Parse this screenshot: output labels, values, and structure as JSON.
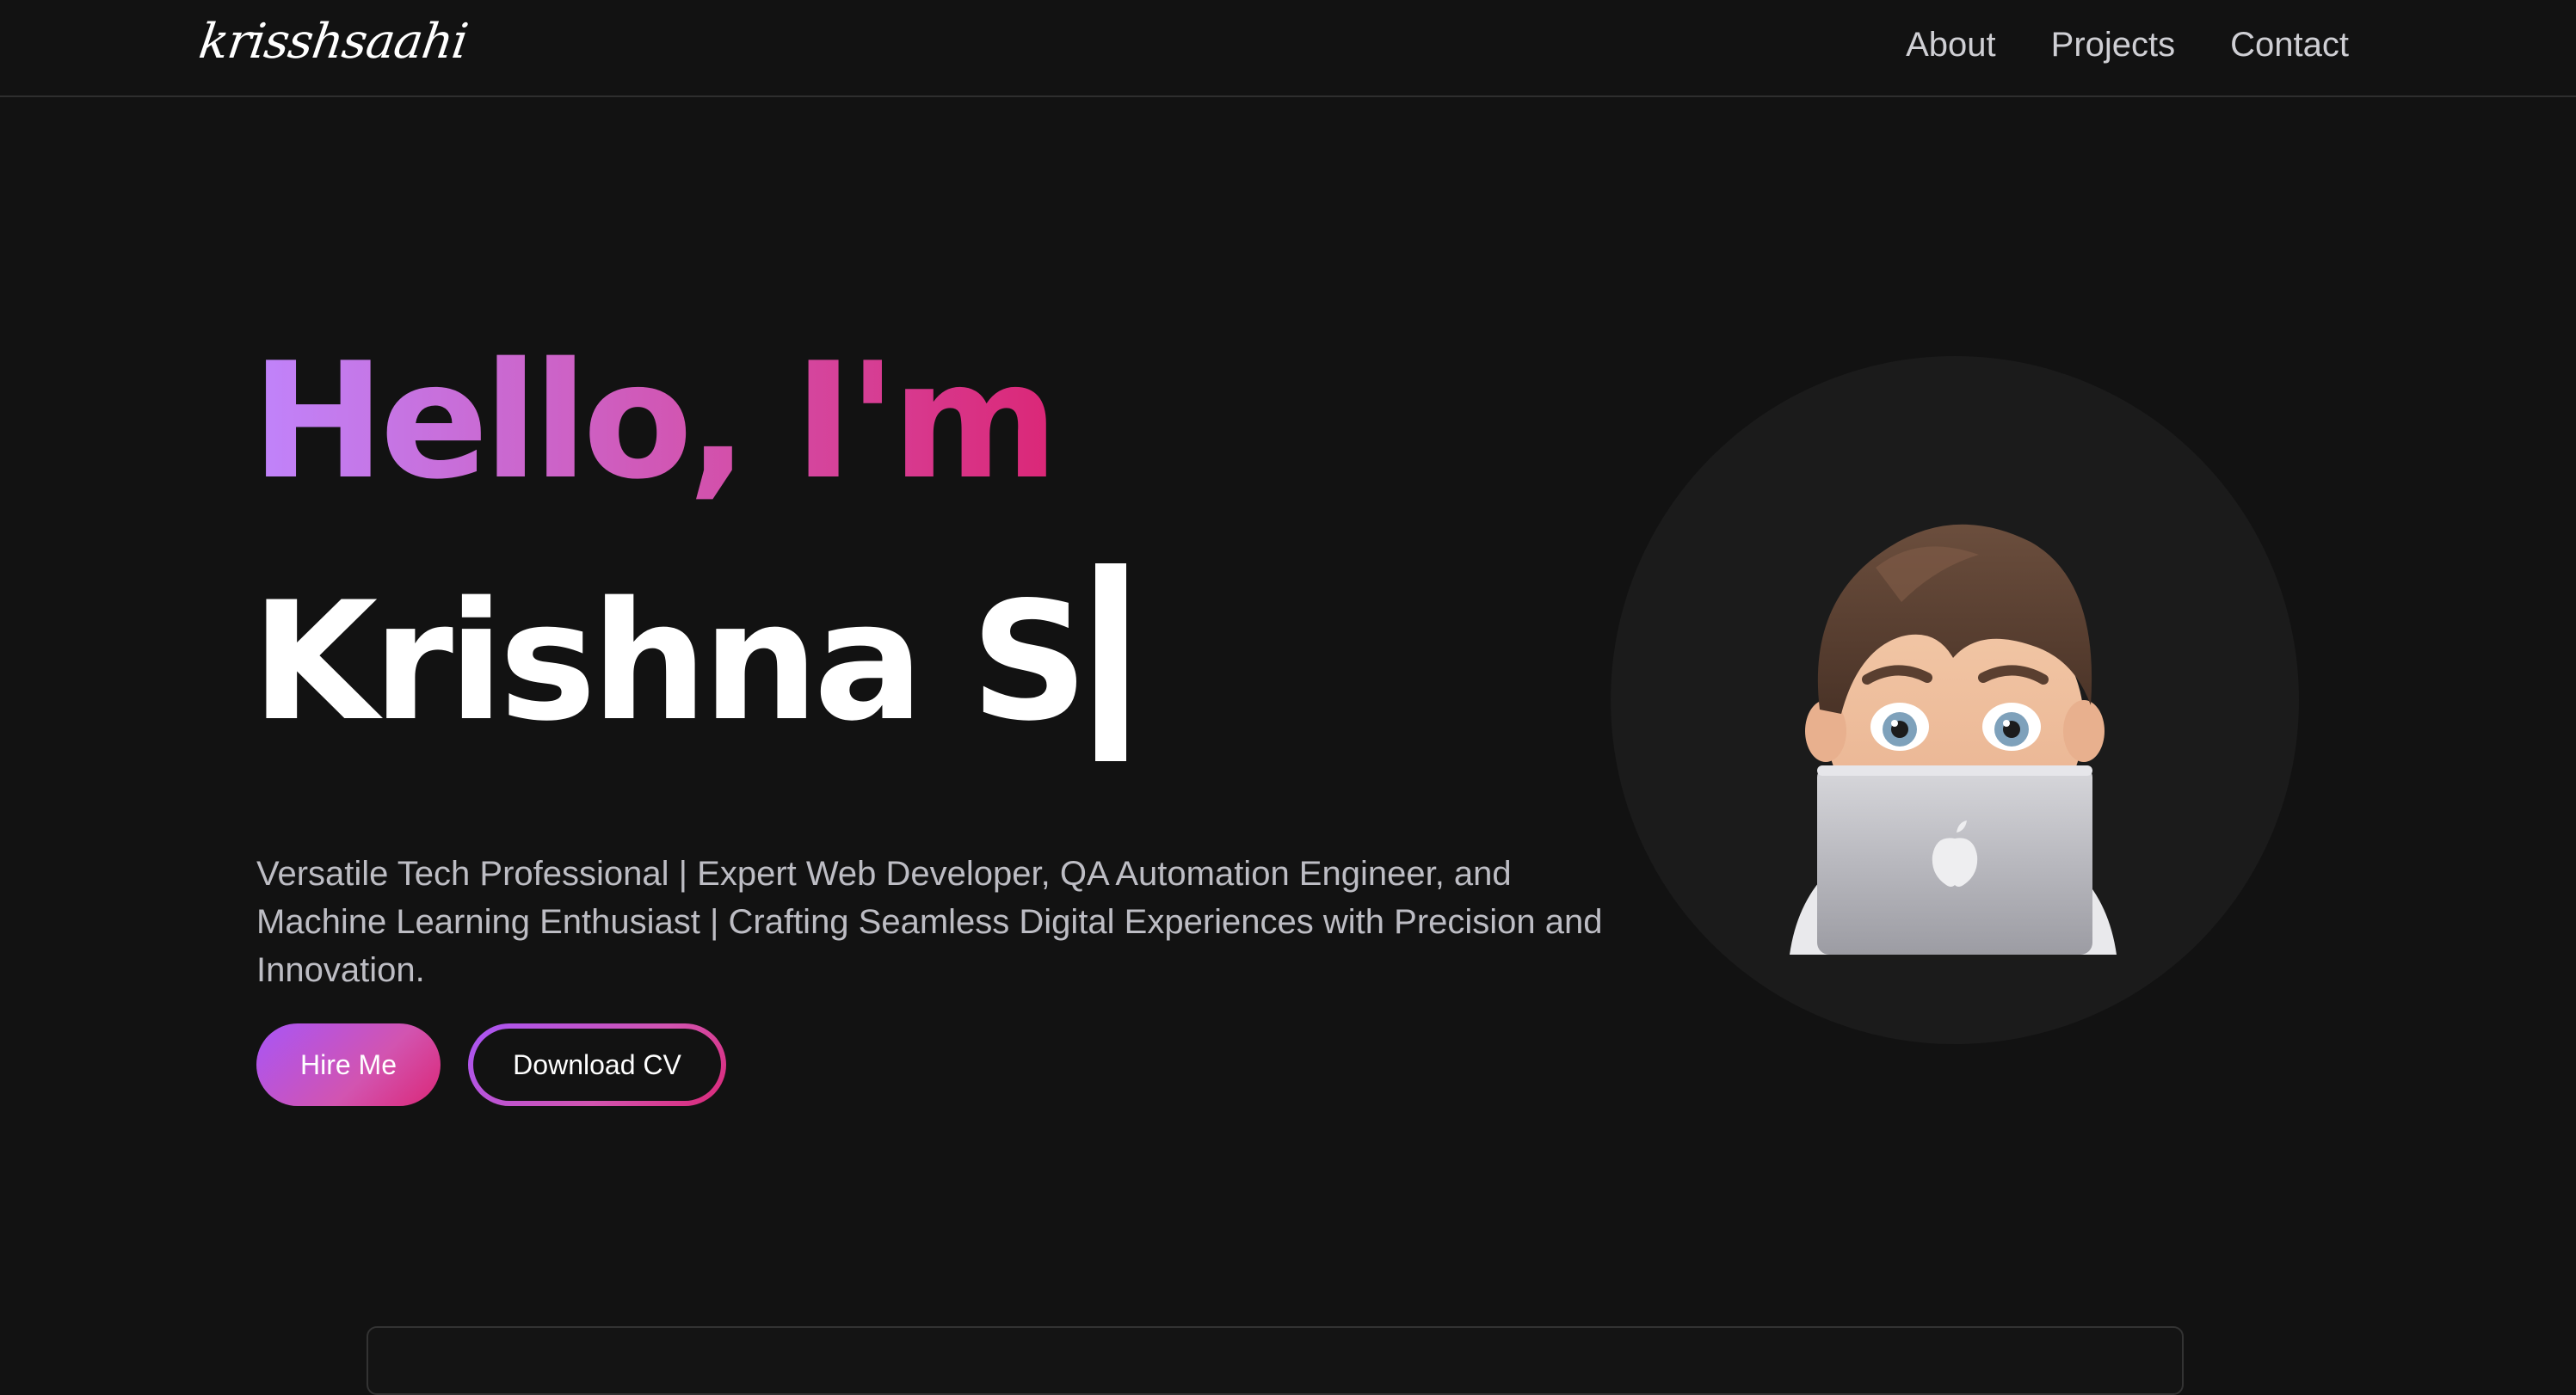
{
  "navbar": {
    "logo": "krisshsaahi",
    "links": [
      {
        "label": "About"
      },
      {
        "label": "Projects"
      },
      {
        "label": "Contact"
      }
    ]
  },
  "hero": {
    "greeting": "Hello, I'm",
    "name": "Krishna S",
    "description": "Versatile Tech Professional | Expert Web Developer, QA Automation Engineer, and Machine Learning Enthusiast | Crafting Seamless Digital Experiences with Precision and Innovation.",
    "hire_label": "Hire Me",
    "cv_label": "Download CV"
  },
  "avatar": {
    "icon": "memoji-laptop-avatar"
  },
  "colors": {
    "background": "#121212",
    "gradient_start": "#a855f7",
    "gradient_end": "#db2777",
    "text_primary": "#ffffff",
    "text_muted": "#bdbdc4"
  }
}
